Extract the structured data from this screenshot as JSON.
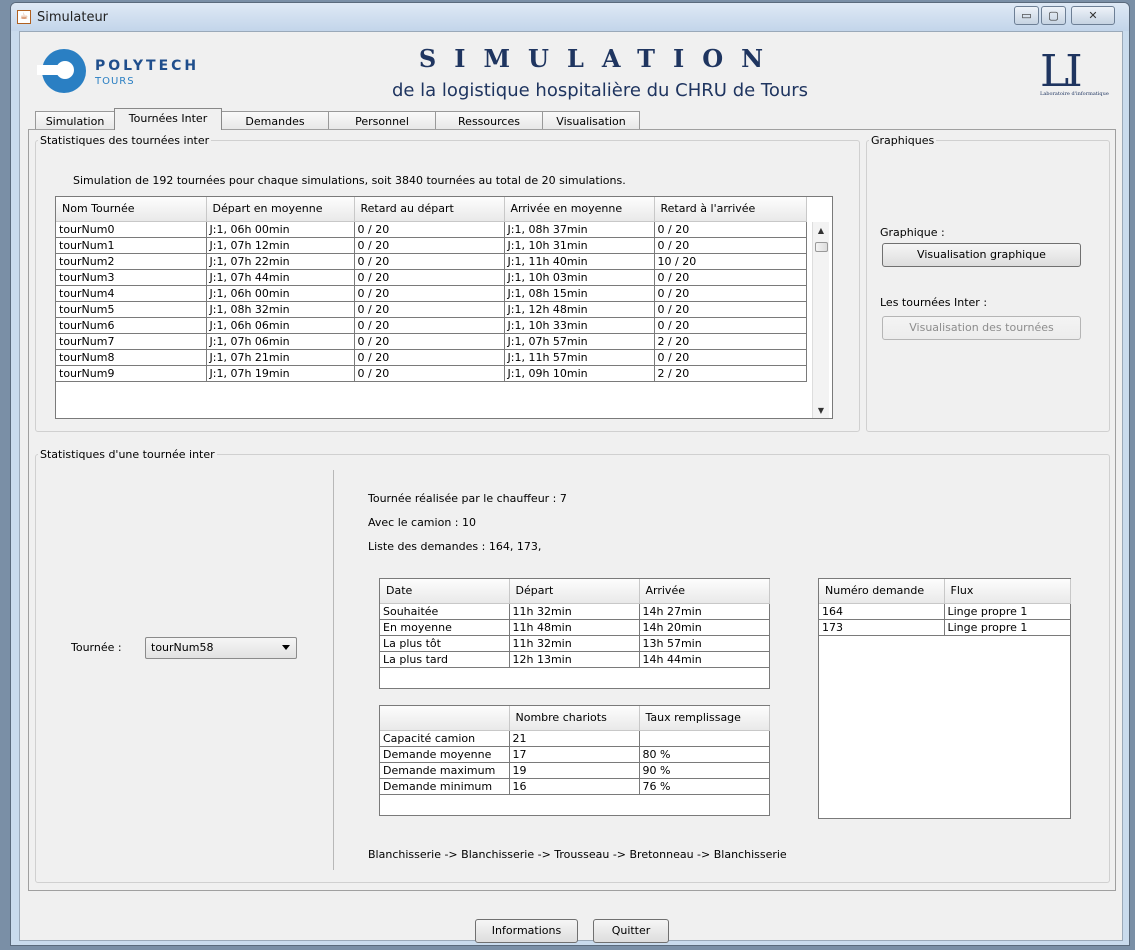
{
  "window": {
    "title": "Simulateur",
    "minimize": "▭",
    "maximize": "▢",
    "close": "✕"
  },
  "header": {
    "school_name": "POLYTECH",
    "school_city": "TOURS",
    "title": "SIMULATION",
    "subtitle": "de la logistique hospitalière du CHRU de Tours",
    "lab_logo": "LI",
    "lab_caption": "Laboratoire d'informatique"
  },
  "tabs": [
    "Simulation",
    "Tournées Inter",
    "Demandes",
    "Personnel",
    "Ressources",
    "Visualisation"
  ],
  "stats_inter": {
    "legend": "Statistiques des tournées inter",
    "summary": "Simulation de 192 tournées pour chaque simulations, soit 3840 tournées au total de 20 simulations.",
    "columns": [
      "Nom Tournée",
      "Départ en moyenne",
      "Retard au départ",
      "Arrivée en moyenne",
      "Retard à l'arrivée"
    ],
    "rows": [
      [
        "tourNum0",
        "J:1, 06h 00min",
        "0 / 20",
        "J:1, 08h 37min",
        "0 / 20"
      ],
      [
        "tourNum1",
        "J:1, 07h 12min",
        "0 / 20",
        "J:1, 10h 31min",
        "0 / 20"
      ],
      [
        "tourNum2",
        "J:1, 07h 22min",
        "0 / 20",
        "J:1, 11h 40min",
        "10 / 20"
      ],
      [
        "tourNum3",
        "J:1, 07h 44min",
        "0 / 20",
        "J:1, 10h 03min",
        "0 / 20"
      ],
      [
        "tourNum4",
        "J:1, 06h 00min",
        "0 / 20",
        "J:1, 08h 15min",
        "0 / 20"
      ],
      [
        "tourNum5",
        "J:1, 08h 32min",
        "0 / 20",
        "J:1, 12h 48min",
        "0 / 20"
      ],
      [
        "tourNum6",
        "J:1, 06h 06min",
        "0 / 20",
        "J:1, 10h 33min",
        "0 / 20"
      ],
      [
        "tourNum7",
        "J:1, 07h 06min",
        "0 / 20",
        "J:1, 07h 57min",
        "2 / 20"
      ],
      [
        "tourNum8",
        "J:1, 07h 21min",
        "0 / 20",
        "J:1, 11h 57min",
        "0 / 20"
      ],
      [
        "tourNum9",
        "J:1, 07h 19min",
        "0 / 20",
        "J:1, 09h 10min",
        "2 / 20"
      ]
    ]
  },
  "graphiques": {
    "legend": "Graphiques",
    "graph_label": "Graphique :",
    "graph_button": "Visualisation graphique",
    "tours_label": "Les tournées Inter :",
    "tours_button": "Visualisation des tournées"
  },
  "stats_one": {
    "legend": "Statistiques d'une tournée inter",
    "tour_label": "Tournée :",
    "tour_selected": "tourNum58",
    "chauffeur": "Tournée réalisée par le chauffeur : 7",
    "camion": "Avec le camion : 10",
    "demandes": "Liste des demandes : 164, 173,",
    "times_columns": [
      "Date",
      "Départ",
      "Arrivée"
    ],
    "times_rows": [
      [
        "Souhaitée",
        "11h 32min",
        "14h 27min"
      ],
      [
        "En moyenne",
        "11h 48min",
        "14h 20min"
      ],
      [
        "La plus tôt",
        "11h 32min",
        "13h 57min"
      ],
      [
        "La plus tard",
        "12h 13min",
        "14h 44min"
      ]
    ],
    "cap_columns": [
      "",
      "Nombre chariots",
      "Taux remplissage"
    ],
    "cap_rows": [
      [
        "Capacité camion",
        "21",
        ""
      ],
      [
        "Demande moyenne",
        "17",
        "80 %"
      ],
      [
        "Demande maximum",
        "19",
        "90 %"
      ],
      [
        "Demande minimum",
        "16",
        "76 %"
      ]
    ],
    "req_columns": [
      "Numéro demande",
      "Flux"
    ],
    "req_rows": [
      [
        "164",
        "Linge propre 1"
      ],
      [
        "173",
        "Linge propre 1"
      ]
    ],
    "route": "Blanchisserie -> Blanchisserie -> Trousseau -> Bretonneau -> Blanchisserie"
  },
  "footer": {
    "info_button": "Informations",
    "quit_button": "Quitter"
  }
}
